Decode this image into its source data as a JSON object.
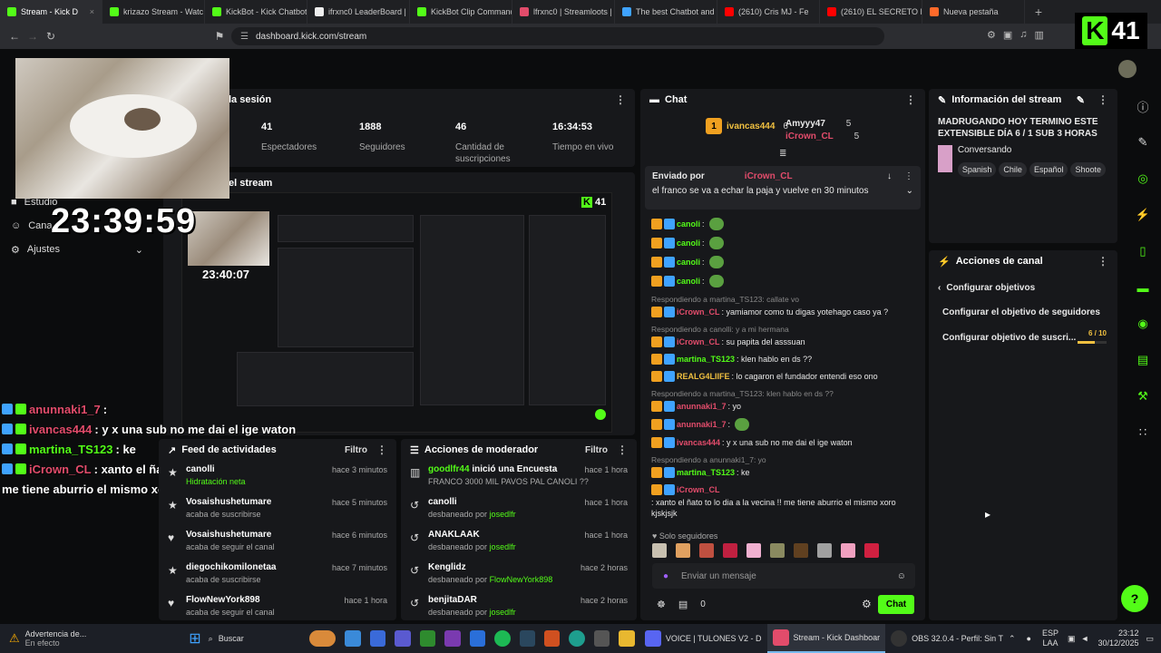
{
  "browser": {
    "tabs": [
      {
        "label": "Stream - Kick D",
        "color": "#53fc18",
        "active": true
      },
      {
        "label": "krizazo Stream - Watc",
        "color": "#53fc18"
      },
      {
        "label": "KickBot - Kick Chatbot",
        "color": "#53fc18"
      },
      {
        "label": "ifrxnc0 LeaderBoard |",
        "color": "#eeeeee"
      },
      {
        "label": "KickBot Clip Command",
        "color": "#53fc18"
      },
      {
        "label": "lfrxnc0 | Streamloots |",
        "color": "#e24c6b"
      },
      {
        "label": "The best Chatbot and",
        "color": "#3fa3ff"
      },
      {
        "label": "(2610) Cris MJ - Fe",
        "color": "#ff0000"
      },
      {
        "label": "(2610) EL SECRETO FIN",
        "color": "#ff0000"
      },
      {
        "label": "Nueva pestaña",
        "color": "#ff6a2a"
      }
    ],
    "new_tab": "+",
    "url": "dashboard.kick.com/stream"
  },
  "kick_badge": {
    "letter": "K",
    "count": "41"
  },
  "sidebar": {
    "items": [
      {
        "label": "Estudio"
      },
      {
        "label": "Cana"
      },
      {
        "label": "Ajustes"
      }
    ]
  },
  "overlay": {
    "clock": "23:39:59",
    "mini_clock": "23:40:07",
    "chat": [
      {
        "user": "anunnaki1_7",
        "text": ":",
        "color": "#e24c6b"
      },
      {
        "user": "ivancas444",
        "text": ": y x una sub no me dai el ige waton",
        "color": "#e24c6b"
      },
      {
        "user": "martina_TS123",
        "text": ": ke",
        "color": "#53fc18"
      },
      {
        "user": "iCrown_CL",
        "text": ": xanto el ñato to lo dia a la vecina !!",
        "color": "#e24c6b"
      },
      {
        "user": "",
        "text": "me tiene aburrio el mismo xoro kjskjsjk",
        "color": "#ffffff"
      }
    ]
  },
  "session": {
    "title": "la sesión",
    "stats": [
      {
        "value": "41",
        "label": "Espectadores"
      },
      {
        "value": "1888",
        "label": "Seguidores"
      },
      {
        "value": "46",
        "label": "Cantidad de suscripciones"
      },
      {
        "value": "16:34:53",
        "label": "Tiempo en vivo"
      }
    ]
  },
  "preview": {
    "title": "el stream"
  },
  "feed": {
    "title": "Feed de actividades",
    "filter": "Filtro",
    "items": [
      {
        "name": "canolli",
        "sub": "Hidratación neta",
        "time": "hace 3 minutos",
        "icon": "★"
      },
      {
        "name": "Vosaishushetumare",
        "sub": "acaba de suscribirse",
        "time": "hace 5 minutos",
        "icon": "★"
      },
      {
        "name": "Vosaishushetumare",
        "sub": "acaba de seguir el canal",
        "time": "hace 6 minutos",
        "icon": "♥"
      },
      {
        "name": "diegochikomilonetaa",
        "sub": "acaba de suscribirse",
        "time": "hace 7 minutos",
        "icon": "★"
      },
      {
        "name": "FlowNewYork898",
        "sub": "acaba de seguir el canal",
        "time": "hace 1 hora",
        "icon": "♥"
      }
    ]
  },
  "mod_actions": {
    "title": "Acciones de moderador",
    "filter": "Filtro",
    "items": [
      {
        "name": "goodlfr44",
        "action": " inició una Encuesta",
        "sub": "FRANCO 3000 MIL PAVOS PAL CANOLI ??",
        "by": "",
        "time": "hace 1 hora"
      },
      {
        "name": "canolli",
        "action": "",
        "sub": "desbaneado por ",
        "by": "josedlfr",
        "time": "hace 1 hora"
      },
      {
        "name": "ANAKLAAK",
        "action": "",
        "sub": "desbaneado por ",
        "by": "josedlfr",
        "time": "hace 1 hora"
      },
      {
        "name": "Kenglidz",
        "action": "",
        "sub": "desbaneado por ",
        "by": "FlowNewYork898",
        "time": "hace 2 horas"
      },
      {
        "name": "benjitaDAR",
        "action": "",
        "sub": "desbaneado por ",
        "by": "josedlfr",
        "time": "hace 2 horas"
      }
    ]
  },
  "chat": {
    "title": "Chat",
    "top_gifters": [
      {
        "rank": "1",
        "name": "ivancas444",
        "count": "6"
      },
      {
        "rank": "",
        "name": "Amyyy47",
        "count": "5"
      },
      {
        "rank": "",
        "name": "iCrown_CL",
        "count": "5"
      }
    ],
    "pinned_by_label": "Enviado por",
    "pinned_user": "iCrown_CL",
    "pinned_text": "el franco se va a echar la paja y vuelve en 30 minutos",
    "messages": [
      {
        "reply": "",
        "user": "canoli",
        "text": ":",
        "color": "#53fc18",
        "emote": true
      },
      {
        "reply": "",
        "user": "canoli",
        "text": ":",
        "color": "#53fc18",
        "emote": true
      },
      {
        "reply": "",
        "user": "canoli",
        "text": ":",
        "color": "#53fc18",
        "emote": true
      },
      {
        "reply": "",
        "user": "canoli",
        "text": ":",
        "color": "#53fc18",
        "emote": true
      },
      {
        "reply": "Respondiendo a martina_TS123: callate vo",
        "user": "iCrown_CL",
        "text": ": yamiamor como tu digas yotehago caso ya ?",
        "color": "#e24c6b",
        "emote": false
      },
      {
        "reply": "Respondiendo a canolli: y a mi hermana",
        "user": "iCrown_CL",
        "text": ": su papita del asssuan",
        "color": "#e24c6b",
        "emote": false
      },
      {
        "reply": "",
        "user": "martina_TS123",
        "text": ": klen hablo en ds ??",
        "color": "#53fc18",
        "emote": false
      },
      {
        "reply": "",
        "user": "REALG4LIIFE",
        "text": ": lo cagaron el fundador entendi eso ono",
        "color": "#f0c040",
        "emote": false
      },
      {
        "reply": "Respondiendo a martina_TS123: klen hablo en ds ??",
        "user": "anunnaki1_7",
        "text": ": yo",
        "color": "#e24c6b",
        "emote": false
      },
      {
        "reply": "",
        "user": "anunnaki1_7",
        "text": ":",
        "color": "#e24c6b",
        "emote": true
      },
      {
        "reply": "",
        "user": "ivancas444",
        "text": ": y x una sub no me dai el ige waton",
        "color": "#e24c6b",
        "emote": false
      },
      {
        "reply": "Respondiendo a anunnaki1_7: yo",
        "user": "martina_TS123",
        "text": ": ke",
        "color": "#53fc18",
        "emote": false
      },
      {
        "reply": "",
        "user": "iCrown_CL",
        "text": ": xanto el ñato to lo dia a la vecina !! me tiene aburrio el mismo xoro kjskjsjk",
        "color": "#e24c6b",
        "emote": false
      }
    ],
    "followers_only": "Solo seguidores",
    "input_placeholder": "Enviar un mensaje",
    "count": "0",
    "send_label": "Chat"
  },
  "stream_info": {
    "title": "Información del stream",
    "stream_title": "MADRUGANDO HOY TERMINO ESTE EXTENSIBLE DÍA 6 / 1 SUB 3 HORAS",
    "category": "Conversando",
    "tags": [
      "Spanish",
      "Chile",
      "Español",
      "Shoote"
    ]
  },
  "channel_actions": {
    "title": "Acciones de canal",
    "back_label": "Configurar objetivos",
    "items": [
      {
        "label": "Configurar el objetivo de seguidores",
        "progress": ""
      },
      {
        "label": "Configurar objetivo de suscri...",
        "progress": "6 / 10",
        "fraction": 0.6
      }
    ]
  },
  "taskbar": {
    "notification_title": "Advertencia de...",
    "notification_sub": "En efecto",
    "search": "Buscar",
    "apps": [
      {
        "label": "VOICE | TULONES V2 - D",
        "active": false
      },
      {
        "label": "Stream - Kick Dashboar",
        "active": true
      },
      {
        "label": "OBS 32.0.4 - Perfil: Sin T",
        "active": false
      }
    ],
    "lang": "ESP",
    "lang_sub": "LAA",
    "time": "23:12",
    "date": "30/12/2025"
  }
}
